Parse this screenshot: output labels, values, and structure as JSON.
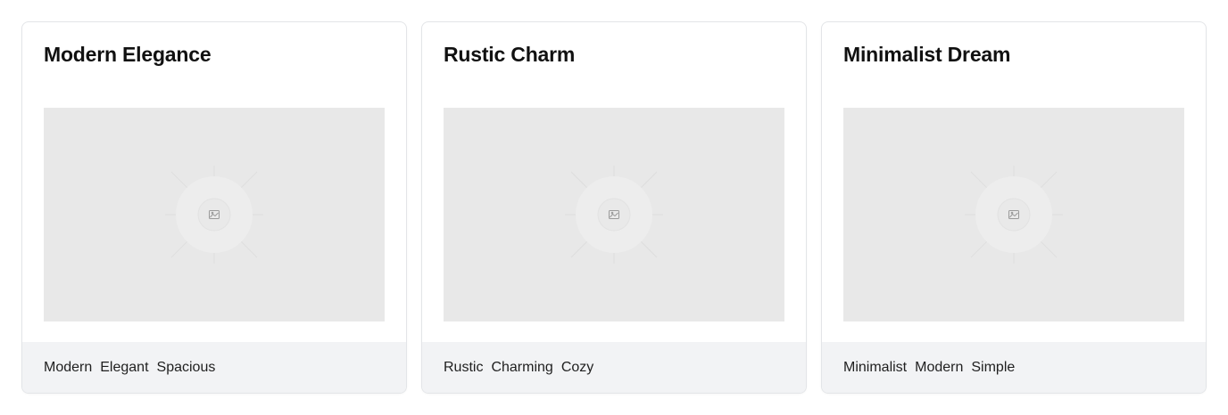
{
  "cards": [
    {
      "title": "Modern Elegance",
      "tags": [
        "Modern",
        "Elegant",
        "Spacious"
      ],
      "image_icon": "image-placeholder-icon"
    },
    {
      "title": "Rustic Charm",
      "tags": [
        "Rustic",
        "Charming",
        "Cozy"
      ],
      "image_icon": "image-placeholder-icon"
    },
    {
      "title": "Minimalist Dream",
      "tags": [
        "Minimalist",
        "Modern",
        "Simple"
      ],
      "image_icon": "image-placeholder-icon"
    }
  ],
  "colors": {
    "card_border": "#e3e5e8",
    "image_placeholder": "#e8e8e8",
    "footer_background": "#f2f3f5",
    "title_text": "#111111",
    "tag_text": "#1f1f1f"
  }
}
